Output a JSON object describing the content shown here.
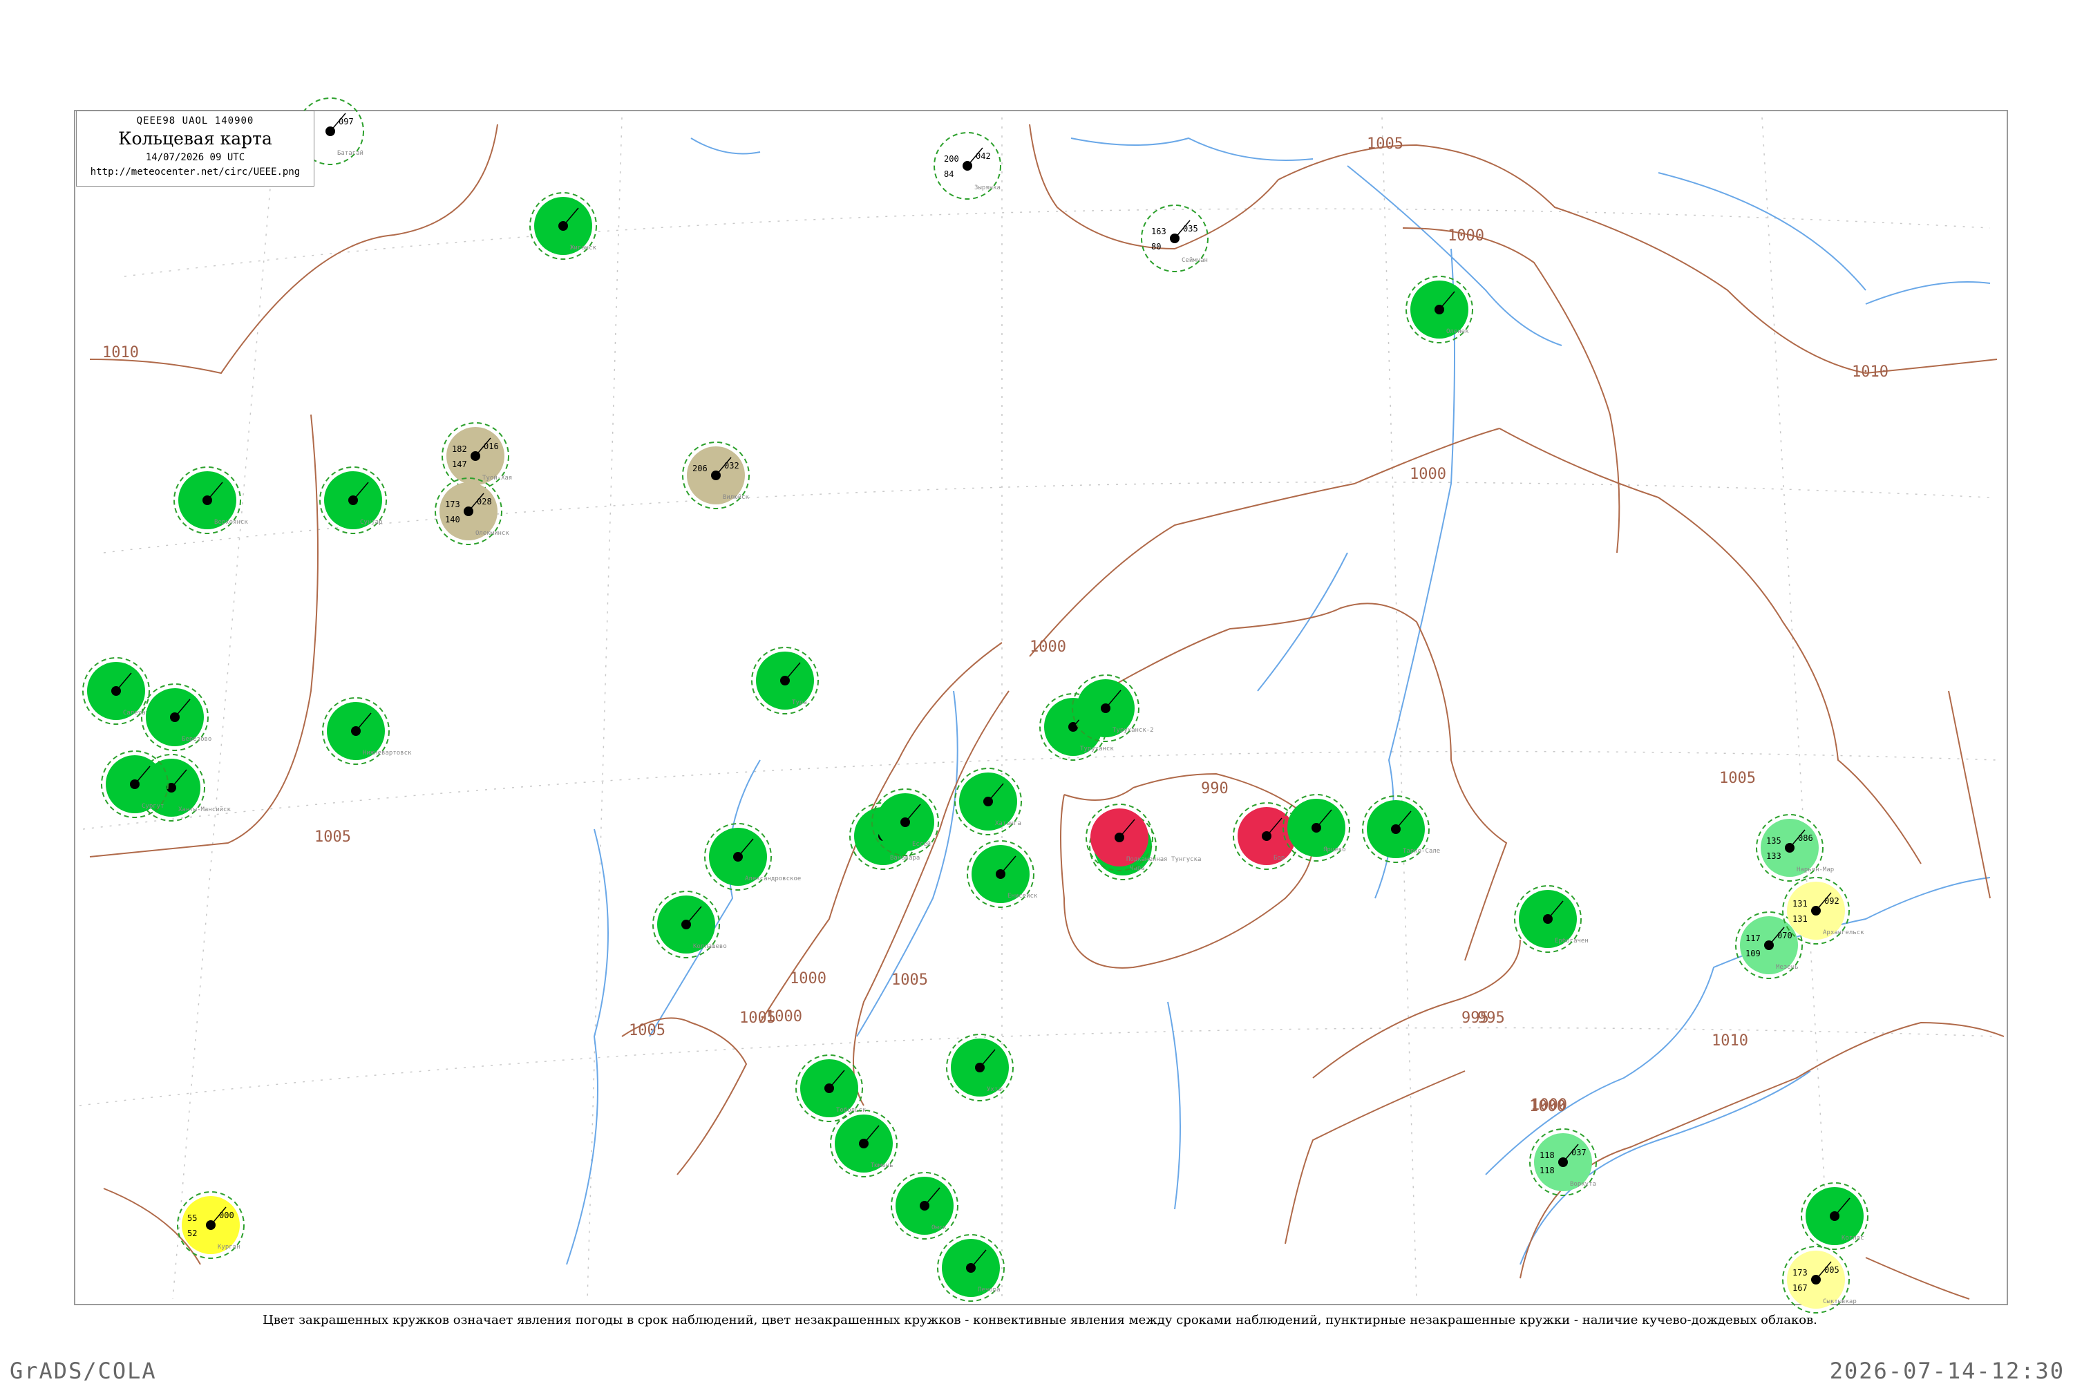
{
  "infobox": {
    "code_line": "QEEE98  UAOL  140900",
    "title": "Кольцевая карта",
    "time": "14/07/2026 09 UTC",
    "url": "http://meteocenter.net/circ/UEEE.png"
  },
  "caption": "Цвет закрашенных кружков означает явления погоды в срок наблюдений, цвет незакрашенных кружков - конвективные явления между сроками наблюдений, пунктирные незакрашенные кружки - наличие кучево-дождевых облаков.",
  "footer": {
    "left": "GrADS/COLA",
    "right": "2026-07-14-12:30"
  },
  "isobar_labels": [
    "1010",
    "1005",
    "1000",
    "1000",
    "1000",
    "1005",
    "1005",
    "1000",
    "995",
    "990",
    "1000",
    "1005",
    "1010",
    "1005",
    "1005",
    "995",
    "1000",
    "1000",
    "1010"
  ],
  "colors": {
    "phenomenon_green": "#00c832",
    "phenomenon_light_green": "#70e890",
    "phenomenon_red": "#e8284e",
    "phenomenon_yellow": "#ffff33",
    "phenomenon_pale_yellow": "#ffff99",
    "phenomenon_orange": "#f5a623",
    "phenomenon_khaki": "#c8be96",
    "convective_ring": "#2ca02c",
    "isobar": "#b06a4a",
    "river": "#6aa8e8",
    "frame": "#9a9a9a"
  },
  "stations": [
    {
      "name": "Сеймчан",
      "fill": "",
      "p": "035",
      "t": "163",
      "td": "80"
    },
    {
      "name": "Зырянка",
      "fill": "",
      "p": "042",
      "t": "200",
      "td": "84"
    },
    {
      "name": "Батагай",
      "fill": "",
      "p": "097",
      "t": "",
      "td": ""
    },
    {
      "name": "Оленек",
      "fill": "green",
      "p": "",
      "t": "",
      "td": ""
    },
    {
      "name": "Туой-Хая",
      "fill": "khaki",
      "p": "016",
      "t": "182",
      "td": "147"
    },
    {
      "name": "Олекминск",
      "fill": "khaki",
      "p": "028",
      "t": "173",
      "td": "140"
    },
    {
      "name": "Вилюйск",
      "fill": "khaki",
      "p": "032",
      "t": "206",
      "td": ""
    },
    {
      "name": "Жиганск",
      "fill": "green",
      "p": "",
      "t": "",
      "td": ""
    },
    {
      "name": "Сунтар",
      "fill": "green",
      "p": "",
      "t": "",
      "td": ""
    },
    {
      "name": "Верхоянск",
      "fill": "green",
      "p": "",
      "t": "",
      "td": ""
    },
    {
      "name": "Ербогачен",
      "fill": "green",
      "p": "",
      "t": "",
      "td": ""
    },
    {
      "name": "Чара",
      "fill": "green",
      "p": "",
      "t": "",
      "td": ""
    },
    {
      "name": "Хатанга",
      "fill": "green",
      "p": "",
      "t": "",
      "td": ""
    },
    {
      "name": "Енисейск",
      "fill": "green",
      "p": "",
      "t": "",
      "td": ""
    },
    {
      "name": "Ванавара",
      "fill": "green",
      "p": "",
      "t": "",
      "td": ""
    },
    {
      "name": "Тура",
      "fill": "green",
      "p": "",
      "t": "",
      "td": ""
    },
    {
      "name": "Ессей",
      "fill": "green",
      "p": "",
      "t": "",
      "td": ""
    },
    {
      "name": "Туруханск",
      "fill": "green",
      "p": "",
      "t": "",
      "td": ""
    },
    {
      "name": "Туруханск-2",
      "fill": "green",
      "p": "",
      "t": "",
      "td": ""
    },
    {
      "name": "Подкаменная Тунгуска",
      "fill": "red",
      "p": "",
      "t": "",
      "td": ""
    },
    {
      "name": "Бор",
      "fill": "red",
      "p": "",
      "t": "",
      "td": ""
    },
    {
      "name": "Ярцево",
      "fill": "green",
      "p": "",
      "t": "",
      "td": ""
    },
    {
      "name": "Тарко-Сале",
      "fill": "green",
      "p": "",
      "t": "",
      "td": ""
    },
    {
      "name": "Салехард",
      "fill": "green",
      "p": "",
      "t": "",
      "td": ""
    },
    {
      "name": "Березово",
      "fill": "green",
      "p": "",
      "t": "",
      "td": ""
    },
    {
      "name": "Ханты-Мансийск",
      "fill": "green",
      "p": "",
      "t": "",
      "td": ""
    },
    {
      "name": "Сургут",
      "fill": "green",
      "p": "",
      "t": "",
      "td": ""
    },
    {
      "name": "Нижневартовск",
      "fill": "green",
      "p": "",
      "t": "",
      "td": ""
    },
    {
      "name": "Александровское",
      "fill": "green",
      "p": "",
      "t": "",
      "td": ""
    },
    {
      "name": "Колпашево",
      "fill": "green",
      "p": "",
      "t": "",
      "td": ""
    },
    {
      "name": "Тобольск",
      "fill": "green",
      "p": "",
      "t": "",
      "td": ""
    },
    {
      "name": "Тюмень",
      "fill": "green",
      "p": "",
      "t": "",
      "td": ""
    },
    {
      "name": "Омск",
      "fill": "green",
      "p": "",
      "t": "",
      "td": ""
    },
    {
      "name": "Курган",
      "fill": "yellow",
      "p": "000",
      "t": "55",
      "td": "52"
    },
    {
      "name": "Воркута",
      "fill": "light_green",
      "p": "037",
      "t": "118",
      "td": "118"
    },
    {
      "name": "Нарьян-Мар",
      "fill": "light_green",
      "p": "086",
      "t": "135",
      "td": "133"
    },
    {
      "name": "Мезень",
      "fill": "light_green",
      "p": "070",
      "t": "117",
      "td": "109"
    },
    {
      "name": "Архангельск",
      "fill": "pale_yellow",
      "p": "092",
      "t": "131",
      "td": "131"
    },
    {
      "name": "Сыктывкар",
      "fill": "pale_yellow",
      "p": "005",
      "t": "173",
      "td": "167"
    },
    {
      "name": "Котлас",
      "fill": "green",
      "p": "",
      "t": "",
      "td": ""
    },
    {
      "name": "Ухта",
      "fill": "green",
      "p": "",
      "t": "",
      "td": ""
    },
    {
      "name": "Печора",
      "fill": "green",
      "p": "",
      "t": "",
      "td": ""
    }
  ]
}
